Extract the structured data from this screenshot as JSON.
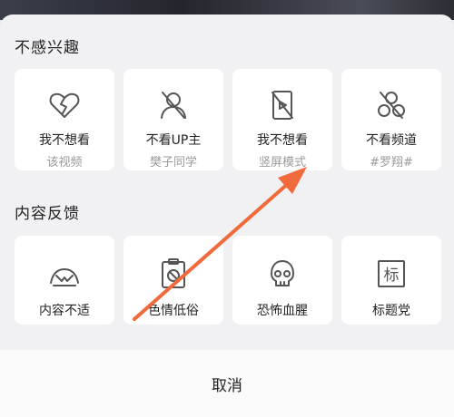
{
  "sections": [
    {
      "title": "不感兴趣"
    },
    {
      "title": "内容反馈"
    }
  ],
  "not_interested": [
    {
      "icon": "heart-broken-icon",
      "title": "我不想看",
      "subtitle": "该视频"
    },
    {
      "icon": "user-blocked-icon",
      "title": "不看UP主",
      "subtitle": "樊子同学"
    },
    {
      "icon": "vertical-screen-blocked-icon",
      "title": "我不想看",
      "subtitle": "竖屏模式"
    },
    {
      "icon": "channel-blocked-icon",
      "title": "不看频道",
      "subtitle": "#罗翔#"
    }
  ],
  "feedback": [
    {
      "icon": "discomfort-icon",
      "title": "内容不适"
    },
    {
      "icon": "prohibited-clipboard-icon",
      "title": "色情低俗"
    },
    {
      "icon": "skull-icon",
      "title": "恐怖血腥"
    },
    {
      "icon": "title-bait-icon",
      "title": "标题党",
      "glyph": "标"
    }
  ],
  "cancel_label": "取消",
  "colors": {
    "annotation_arrow": "#f06a3c",
    "icon_stroke": "#555555"
  }
}
